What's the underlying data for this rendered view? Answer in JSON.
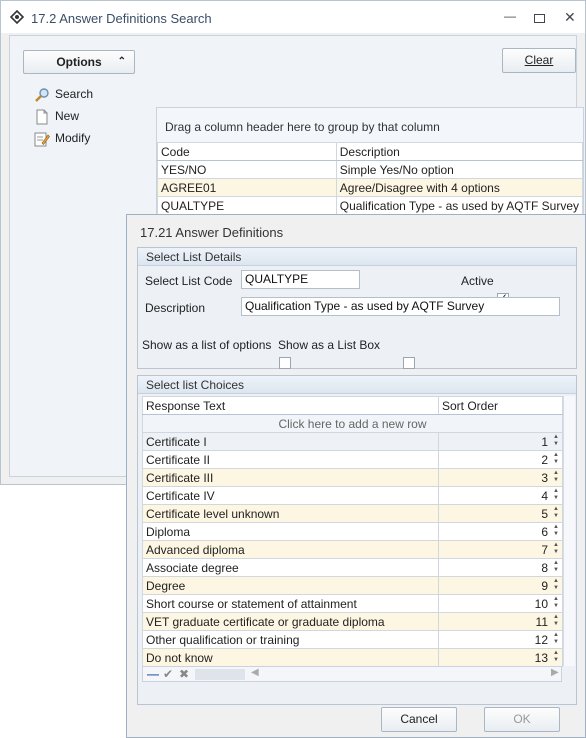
{
  "main_window": {
    "title": "17.2 Answer Definitions Search",
    "options_label": "Options",
    "clear_label": "Clear",
    "menu": [
      {
        "label": "Search",
        "icon": "search-icon"
      },
      {
        "label": "New",
        "icon": "new-document-icon"
      },
      {
        "label": "Modify",
        "icon": "edit-icon"
      }
    ],
    "grid": {
      "group_hint": "Drag a column header here to group by that column",
      "columns": [
        "Code",
        "Description"
      ],
      "rows": [
        [
          "YES/NO",
          "Simple Yes/No option"
        ],
        [
          "AGREE01",
          "Agree/Disagree with 4 options"
        ],
        [
          "QUALTYPE",
          "Qualification Type - as used by AQTF Survey"
        ]
      ]
    }
  },
  "dialog": {
    "title": "17.21 Answer Definitions",
    "details_header": "Select List Details",
    "code_label": "Select List Code",
    "code_value": "QUALTYPE",
    "active_label": "Active",
    "active_checked": true,
    "description_label": "Description",
    "description_value": "Qualification Type - as used by AQTF Survey",
    "show_options_label": "Show as a list of options",
    "show_listbox_label": "Show as a List Box",
    "choices_header": "Select list Choices",
    "columns": [
      "Response Text",
      "Sort Order"
    ],
    "add_row_hint": "Click here to add a new row",
    "choices": [
      {
        "text": "Certificate I",
        "order": "1"
      },
      {
        "text": "Certificate II",
        "order": "2"
      },
      {
        "text": "Certificate III",
        "order": "3"
      },
      {
        "text": "Certificate IV",
        "order": "4"
      },
      {
        "text": "Certificate level unknown",
        "order": "5"
      },
      {
        "text": "Diploma",
        "order": "6"
      },
      {
        "text": "Advanced diploma",
        "order": "7"
      },
      {
        "text": "Associate degree",
        "order": "8"
      },
      {
        "text": "Degree",
        "order": "9"
      },
      {
        "text": "Short course or statement of attainment",
        "order": "10"
      },
      {
        "text": "VET graduate certificate or graduate diploma",
        "order": "11"
      },
      {
        "text": "Other qualification or training",
        "order": "12"
      },
      {
        "text": "Do not know",
        "order": "13"
      }
    ],
    "cancel_label": "Cancel",
    "ok_label": "OK"
  }
}
